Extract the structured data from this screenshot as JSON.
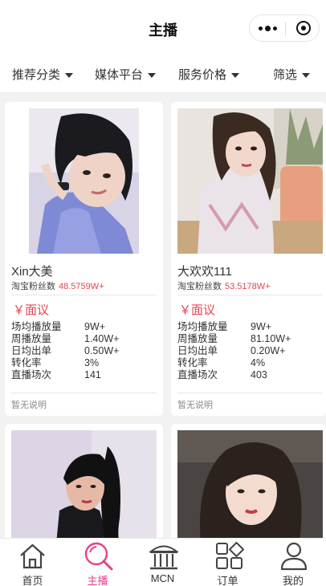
{
  "nav": {
    "title": "主播"
  },
  "filters": [
    {
      "label": "推荐分类"
    },
    {
      "label": "媒体平台"
    },
    {
      "label": "服务价格"
    },
    {
      "label": "筛选"
    }
  ],
  "anchors": [
    {
      "name": "Xin大美",
      "fans_label": "淘宝粉丝数",
      "fans_value": "48.5759W+",
      "price": "￥面议",
      "stats": [
        {
          "label": "场均播放量",
          "value": "9W+"
        },
        {
          "label": "周播放量",
          "value": "1.40W+"
        },
        {
          "label": "日均出单",
          "value": "0.50W+"
        },
        {
          "label": "转化率",
          "value": "3%"
        },
        {
          "label": "直播场次",
          "value": "141"
        }
      ],
      "note": "暂无说明"
    },
    {
      "name": "大欢欢111",
      "fans_label": "淘宝粉丝数",
      "fans_value": "53.5178W+",
      "price": "￥面议",
      "stats": [
        {
          "label": "场均播放量",
          "value": "9W+"
        },
        {
          "label": "周播放量",
          "value": "81.10W+"
        },
        {
          "label": "日均出单",
          "value": "0.20W+"
        },
        {
          "label": "转化率",
          "value": "4%"
        },
        {
          "label": "直播场次",
          "value": "403"
        }
      ],
      "note": "暂无说明"
    }
  ],
  "tabbar": [
    {
      "label": "首页",
      "icon": "home-icon"
    },
    {
      "label": "主播",
      "icon": "magnifier-icon",
      "active": true
    },
    {
      "label": "MCN",
      "icon": "building-icon"
    },
    {
      "label": "订单",
      "icon": "grid-icon"
    },
    {
      "label": "我的",
      "icon": "user-icon"
    }
  ],
  "colors": {
    "accent": "#e8434f",
    "tab_active": "#e5408a"
  }
}
